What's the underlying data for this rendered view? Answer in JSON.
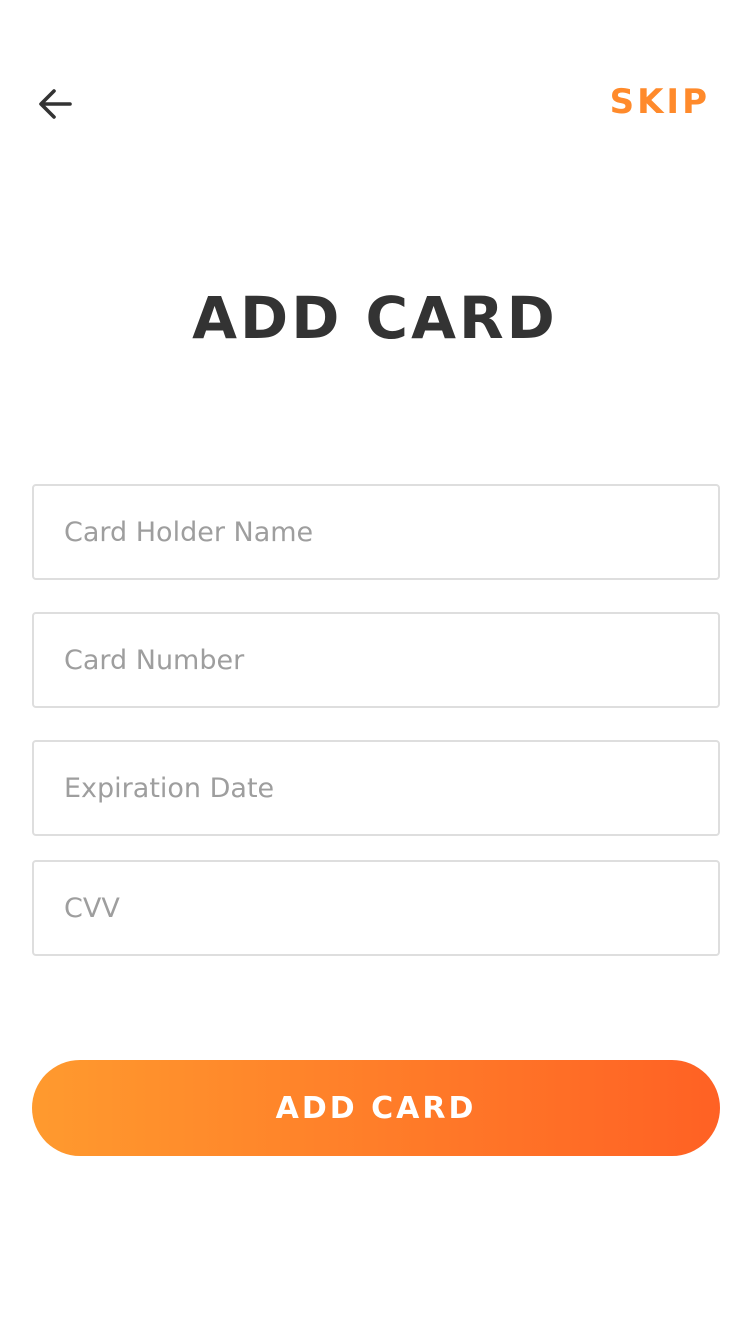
{
  "colors": {
    "accent": "#ff8a2b",
    "gradient_start": "#ff9a2e",
    "gradient_end": "#ff6124",
    "title": "#333333",
    "icon": "#333333"
  },
  "header": {
    "back_icon": "arrow-left-icon",
    "skip_label": "SKIP"
  },
  "title": "ADD CARD",
  "form": {
    "card_holder_placeholder": "Card Holder Name",
    "card_number_placeholder": "Card Number",
    "expiration_placeholder": "Expiration Date",
    "cvv_placeholder": "CVV"
  },
  "submit_label": "ADD CARD"
}
